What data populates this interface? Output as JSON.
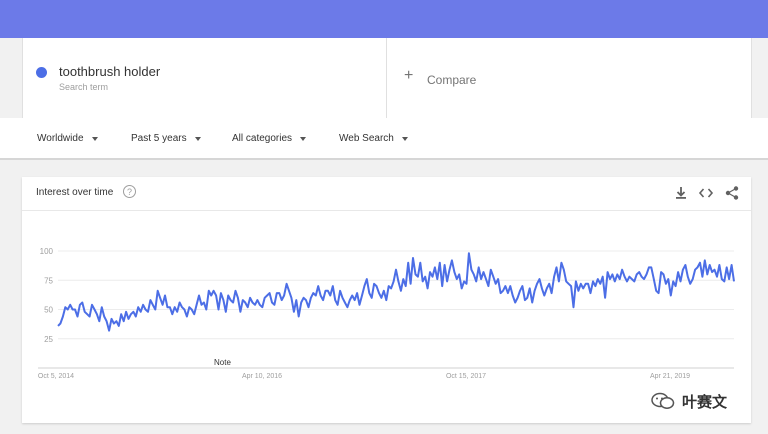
{
  "search": {
    "term": "toothbrush holder",
    "term_type": "Search term",
    "term_color": "#4c6ee6",
    "compare_label": "Compare"
  },
  "filters": {
    "region": "Worldwide",
    "period": "Past 5 years",
    "category": "All categories",
    "search_type": "Web Search"
  },
  "card": {
    "title": "Interest over time",
    "icons": [
      "help-icon",
      "download-icon",
      "embed-icon",
      "share-icon"
    ]
  },
  "chart_data": {
    "type": "line",
    "title": "",
    "xlabel": "",
    "ylabel": "",
    "ylim": [
      0,
      100
    ],
    "yticks": [
      25,
      50,
      75,
      100
    ],
    "xtick_labels": [
      "Oct 5, 2014",
      "Apr 10, 2016",
      "Oct 15, 2017",
      "Apr 21, 2019"
    ],
    "annotation": "Note",
    "grid": true,
    "line_color": "#4c6ee6",
    "series": [
      {
        "values": [
          36,
          38,
          44,
          52,
          50,
          54,
          50,
          50,
          44,
          54,
          56,
          48,
          46,
          44,
          54,
          50,
          46,
          40,
          52,
          44,
          40,
          32,
          42,
          38,
          40,
          36,
          46,
          40,
          48,
          42,
          46,
          48,
          44,
          52,
          48,
          54,
          50,
          48,
          58,
          54,
          50,
          66,
          60,
          54,
          62,
          52,
          52,
          46,
          52,
          48,
          56,
          52,
          50,
          44,
          52,
          50,
          46,
          54,
          62,
          54,
          56,
          50,
          66,
          62,
          66,
          62,
          50,
          64,
          58,
          48,
          62,
          58,
          56,
          66,
          60,
          48,
          58,
          56,
          52,
          60,
          56,
          54,
          58,
          54,
          52,
          60,
          62,
          64,
          56,
          54,
          64,
          64,
          58,
          62,
          72,
          66,
          60,
          48,
          58,
          44,
          56,
          60,
          58,
          52,
          60,
          64,
          62,
          70,
          62,
          58,
          66,
          66,
          62,
          70,
          58,
          54,
          66,
          60,
          56,
          52,
          58,
          62,
          58,
          64,
          54,
          62,
          70,
          76,
          64,
          60,
          72,
          70,
          64,
          60,
          66,
          58,
          70,
          68,
          74,
          84,
          74,
          66,
          76,
          70,
          90,
          72,
          94,
          80,
          78,
          90,
          74,
          78,
          68,
          82,
          78,
          86,
          76,
          90,
          70,
          88,
          74,
          84,
          92,
          82,
          76,
          80,
          68,
          74,
          72,
          98,
          84,
          80,
          74,
          86,
          76,
          82,
          76,
          70,
          84,
          78,
          72,
          76,
          64,
          66,
          70,
          64,
          70,
          62,
          56,
          60,
          66,
          70,
          58,
          60,
          68,
          56,
          66,
          72,
          76,
          68,
          62,
          68,
          72,
          64,
          78,
          86,
          74,
          90,
          84,
          74,
          72,
          70,
          52,
          74,
          66,
          72,
          68,
          72,
          72,
          64,
          74,
          70,
          76,
          72,
          78,
          60,
          82,
          76,
          80,
          74,
          80,
          76,
          84,
          78,
          74,
          78,
          76,
          74,
          80,
          82,
          78,
          76,
          80,
          86,
          86,
          76,
          66,
          64,
          82,
          80,
          72,
          76,
          62,
          74,
          70,
          82,
          74,
          84,
          88,
          78,
          72,
          76,
          84,
          86,
          90,
          78,
          92,
          80,
          88,
          82,
          84,
          78,
          88,
          76,
          74,
          86,
          76,
          88,
          74
        ]
      }
    ]
  },
  "watermark": {
    "text": "叶赛文"
  }
}
